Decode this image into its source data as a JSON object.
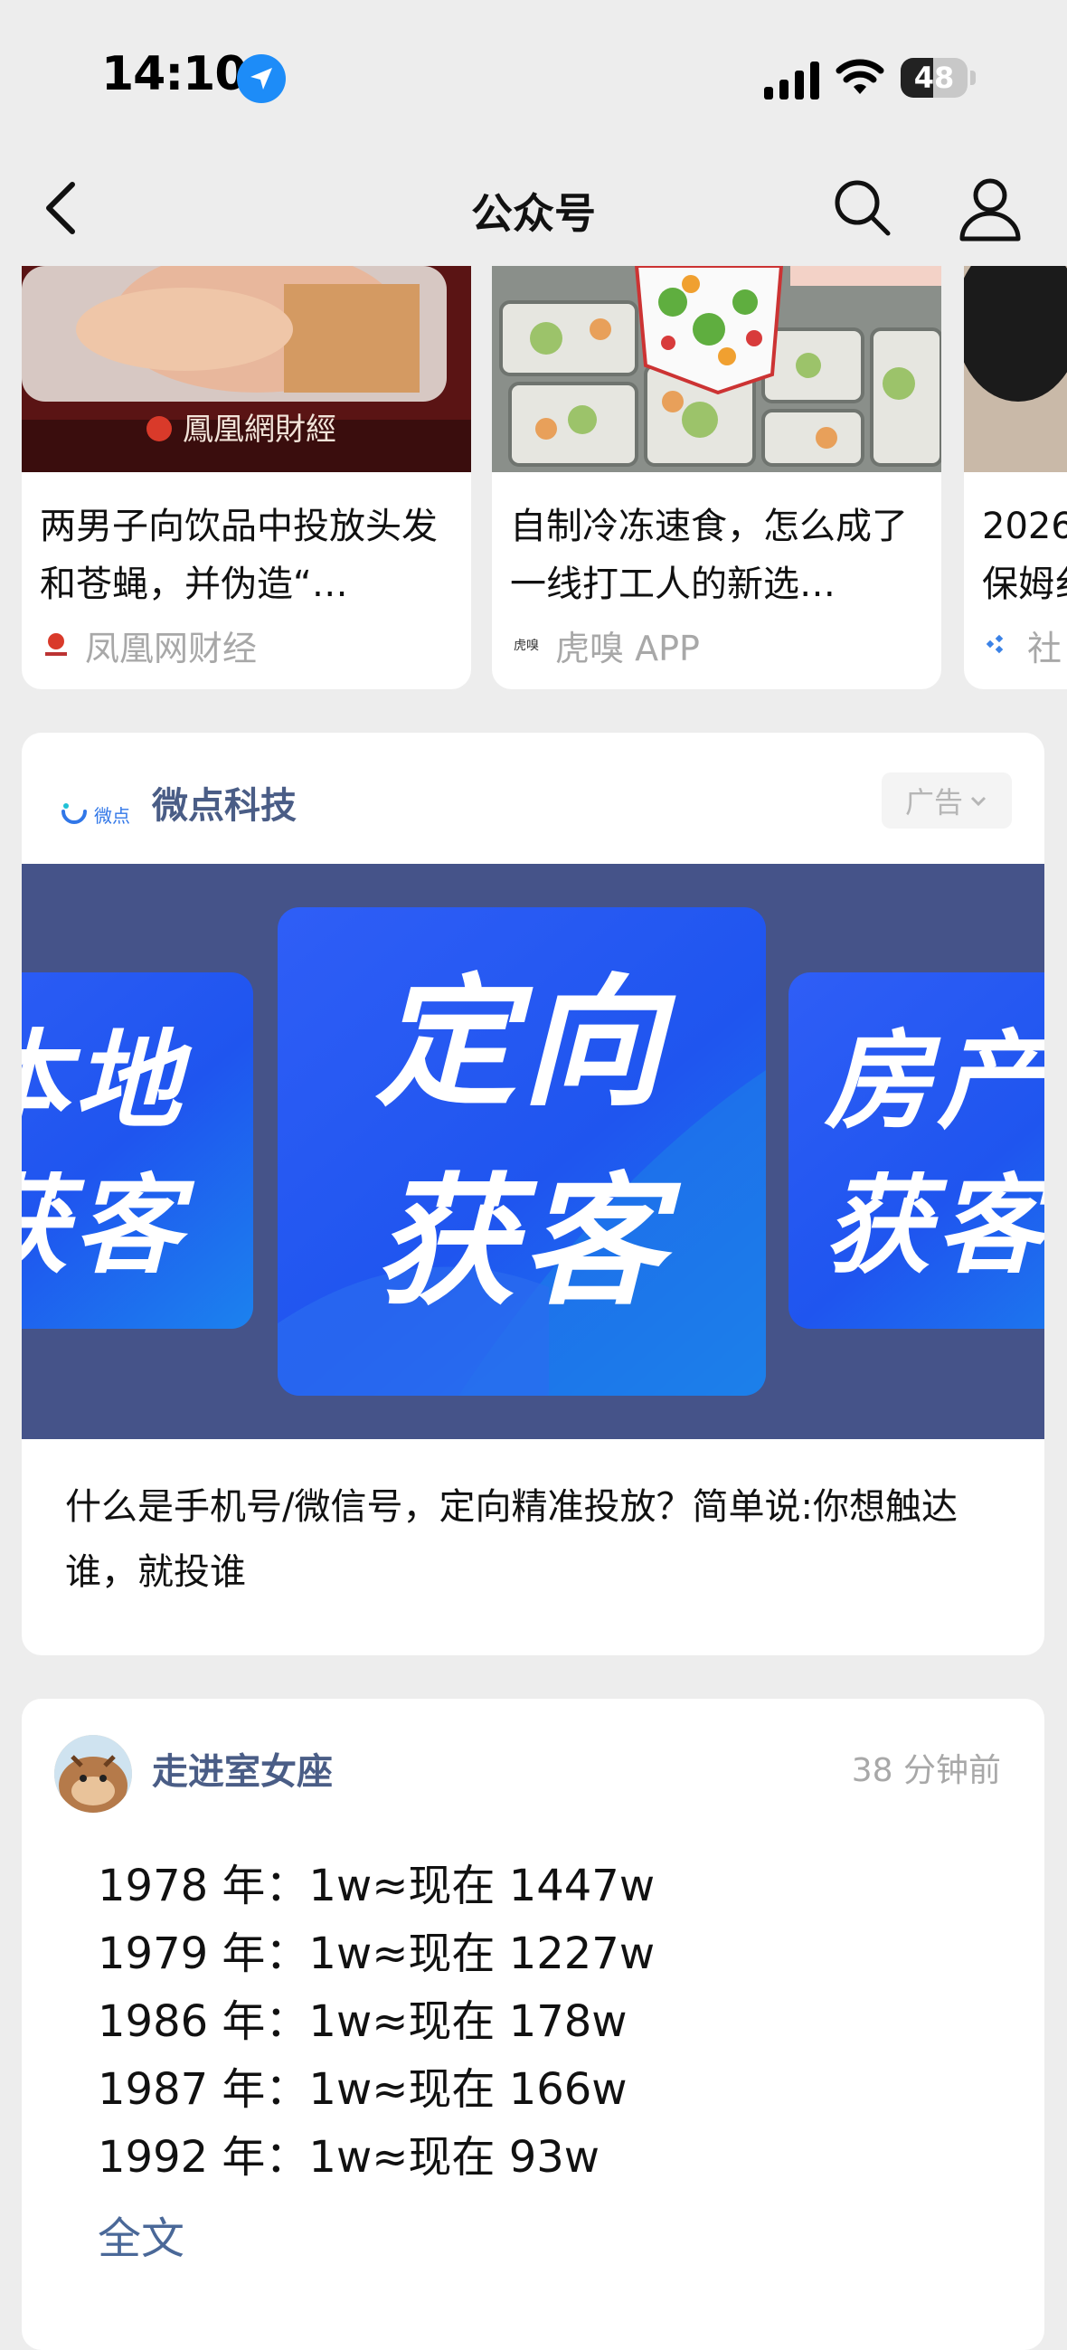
{
  "status_bar": {
    "time": "14:10",
    "battery": "48",
    "battery_level": 0.48
  },
  "nav": {
    "title": "公众号"
  },
  "articles": [
    {
      "image_caption": "鳳凰網財經",
      "title": "两男子向饮品中投放头发和苍蝇，并伪造“…",
      "source": "凤凰网财经"
    },
    {
      "title": "自制冷冻速食，怎么成了一线打工人的新选…",
      "source": "虎嗅 APP",
      "source_logo_text": "虎嗅"
    },
    {
      "title": "2026\n保姆纟",
      "source": "社"
    }
  ],
  "ad": {
    "brand_logo_text": "微点",
    "advertiser": "微点科技",
    "badge": "广告",
    "banner": {
      "left_tile": "本地\n获客",
      "center_tile": "定向\n获客",
      "right_tile": "房产\n获客"
    },
    "text": "什么是手机号/微信号，定向精准投放？简单说:你想触达谁，就投谁"
  },
  "post": {
    "author": "走进室女座",
    "time": "38 分钟前",
    "lines": [
      "1978 年：1w≈现在 1447w",
      "1979 年：1w≈现在 1227w",
      "1986 年：1w≈现在 178w",
      "1987 年：1w≈现在 166w",
      "1992 年：1w≈现在 93w"
    ],
    "more": "全文"
  },
  "colors": {
    "background": "#ededed",
    "link": "#4a5d86",
    "ad_blue": "#2f5ef6",
    "ad_banner_bg": "#455389",
    "location_blue": "#1d8cf8"
  }
}
